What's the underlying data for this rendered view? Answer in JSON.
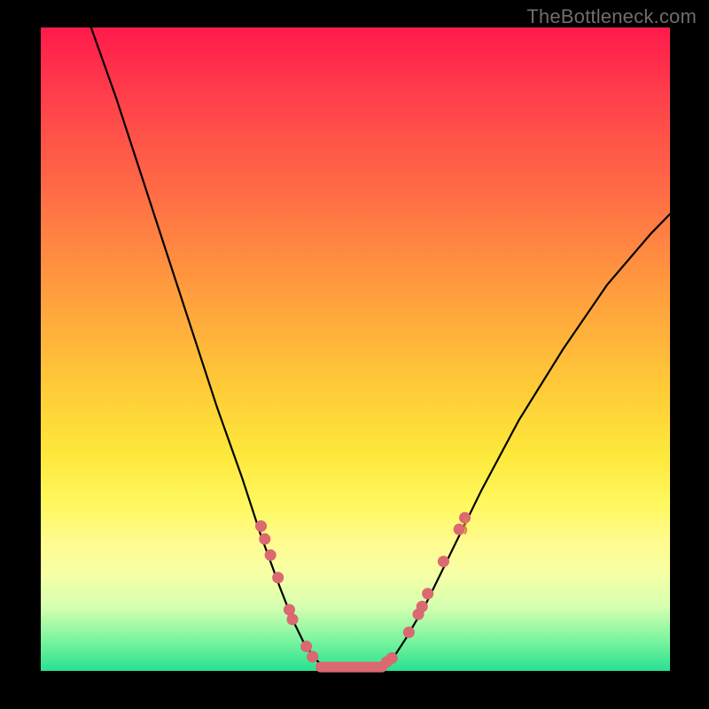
{
  "watermark": "TheBottleneck.com",
  "colors": {
    "marker": "#db6971",
    "curve": "#000000",
    "flat_segment": "#db6971",
    "brace": "#d48a3a"
  },
  "chart_data": {
    "type": "line",
    "title": "",
    "xlabel": "",
    "ylabel": "",
    "xlim": [
      0,
      100
    ],
    "ylim": [
      0,
      100
    ],
    "grid": false,
    "legend": false,
    "series": [
      {
        "name": "left_branch",
        "x": [
          8,
          12,
          16,
          20,
          24,
          28,
          32,
          35,
          38,
          40,
          42,
          44,
          45
        ],
        "y": [
          100,
          89,
          77,
          65,
          53,
          41,
          30,
          21,
          13,
          8,
          4,
          1.5,
          0.5
        ]
      },
      {
        "name": "flat_minimum",
        "x": [
          45,
          46,
          48,
          50,
          52,
          54
        ],
        "y": [
          0.5,
          0.4,
          0.3,
          0.3,
          0.3,
          0.4
        ]
      },
      {
        "name": "right_branch",
        "x": [
          54,
          56,
          58,
          61,
          65,
          70,
          76,
          83,
          90,
          97,
          100
        ],
        "y": [
          0.4,
          2,
          5,
          10,
          18,
          28,
          39,
          50,
          60,
          68,
          71
        ]
      }
    ],
    "markers_left": [
      {
        "x": 35.0,
        "y": 22.5
      },
      {
        "x": 35.6,
        "y": 20.5
      },
      {
        "x": 36.5,
        "y": 18.0
      },
      {
        "x": 37.7,
        "y": 14.5
      },
      {
        "x": 39.5,
        "y": 9.5
      },
      {
        "x": 40.0,
        "y": 8.0
      },
      {
        "x": 42.2,
        "y": 3.8
      },
      {
        "x": 43.2,
        "y": 2.2
      }
    ],
    "markers_right": [
      {
        "x": 55.0,
        "y": 1.4
      },
      {
        "x": 55.8,
        "y": 2.0
      },
      {
        "x": 58.5,
        "y": 6.0
      },
      {
        "x": 60.0,
        "y": 8.8
      },
      {
        "x": 60.6,
        "y": 10.0
      },
      {
        "x": 61.5,
        "y": 12.0
      },
      {
        "x": 64.0,
        "y": 17.0
      },
      {
        "x": 66.5,
        "y": 22.0
      },
      {
        "x": 67.4,
        "y": 23.8
      }
    ],
    "flat_segment": {
      "x0": 44.5,
      "x1": 54.2,
      "y": 0.6
    },
    "brace": {
      "x": 66.5,
      "y": 22.5
    }
  }
}
